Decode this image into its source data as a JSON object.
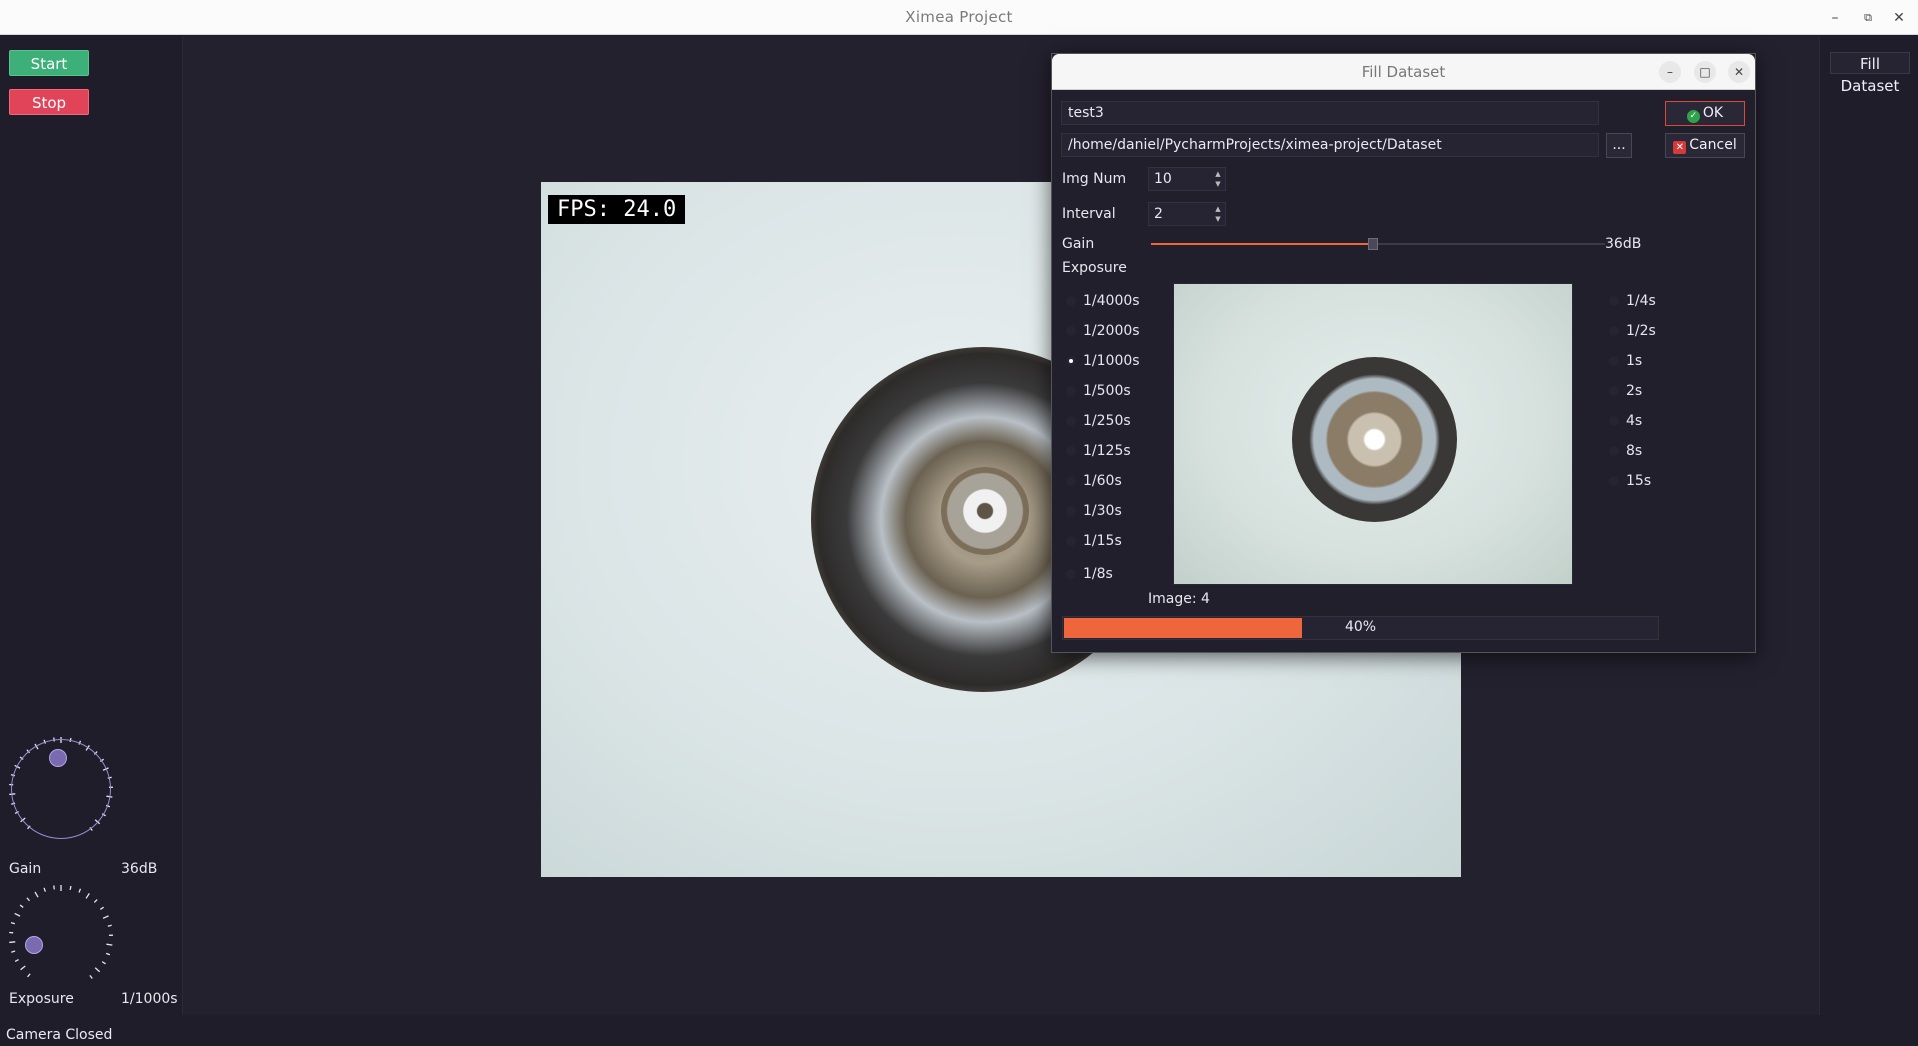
{
  "window": {
    "title": "Ximea Project"
  },
  "controls": {
    "start_label": "Start",
    "stop_label": "Stop",
    "fill_dataset_label": "Fill Dataset"
  },
  "camera": {
    "fps_text": "FPS: 24.0"
  },
  "gain": {
    "label": "Gain",
    "value": "36dB"
  },
  "exposure": {
    "label": "Exposure",
    "value": "1/1000s"
  },
  "status": {
    "text": "Camera Closed"
  },
  "dialog": {
    "title": "Fill Dataset",
    "name_value": "test3",
    "path_value": "/home/daniel/PycharmProjects/ximea-project/Dataset",
    "browse_label": "...",
    "ok_label": "OK",
    "cancel_label": "Cancel",
    "img_num_label": "Img Num",
    "img_num_value": "10",
    "interval_label": "Interval",
    "interval_value": "2",
    "gain_label": "Gain",
    "gain_value": "36dB",
    "gain_fraction": 0.49,
    "exposure_label": "Exposure",
    "exposure_left": [
      "1/4000s",
      "1/2000s",
      "1/1000s",
      "1/500s",
      "1/250s",
      "1/125s",
      "1/60s",
      "1/30s",
      "1/15s",
      "1/8s"
    ],
    "exposure_right": [
      "1/4s",
      "1/2s",
      "1s",
      "2s",
      "4s",
      "8s",
      "15s"
    ],
    "exposure_selected": "1/1000s",
    "image_counter": "Image: 4",
    "progress_percent": 40,
    "progress_text": "40%"
  },
  "colors": {
    "accent": "#f0663c",
    "start": "#3daf78",
    "stop": "#e14459",
    "background": "#201d2b"
  }
}
